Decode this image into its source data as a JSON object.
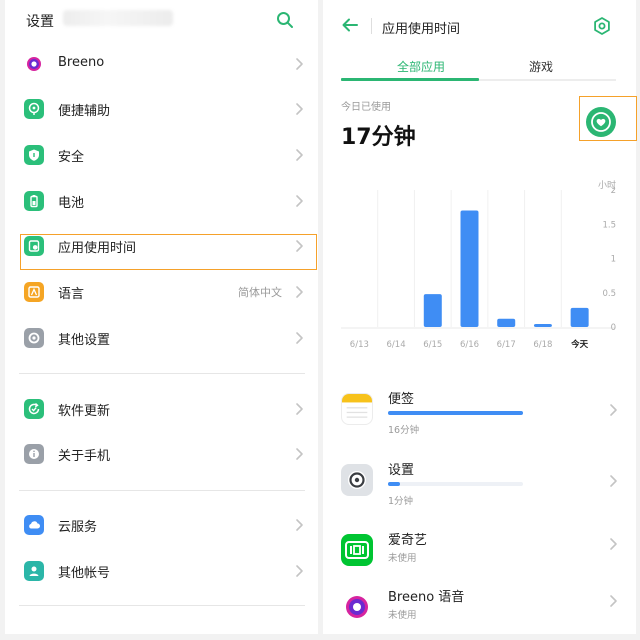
{
  "left": {
    "title": "设置",
    "groups": [
      [
        {
          "label": "Breeno",
          "value": "",
          "icon": "breeno-icon",
          "color": "#ffffff"
        },
        {
          "label": "便捷辅助",
          "value": "",
          "icon": "assist-icon",
          "color": "#2bbf7a"
        },
        {
          "label": "安全",
          "value": "",
          "icon": "security-shield-icon",
          "color": "#2bbf7a"
        },
        {
          "label": "电池",
          "value": "",
          "icon": "battery-icon",
          "color": "#2bbf7a"
        },
        {
          "label": "应用使用时间",
          "value": "",
          "icon": "app-usage-icon",
          "color": "#2bbf7a"
        },
        {
          "label": "语言",
          "value": "简体中文",
          "icon": "language-icon",
          "color": "#f5a524"
        },
        {
          "label": "其他设置",
          "value": "",
          "icon": "other-settings-icon",
          "color": "#9aa0a8"
        }
      ],
      [
        {
          "label": "软件更新",
          "value": "",
          "icon": "update-icon",
          "color": "#2bbf7a"
        },
        {
          "label": "关于手机",
          "value": "",
          "icon": "about-phone-icon",
          "color": "#9aa0a8"
        }
      ],
      [
        {
          "label": "云服务",
          "value": "",
          "icon": "cloud-icon",
          "color": "#3f8df4"
        },
        {
          "label": "其他帐号",
          "value": "",
          "icon": "account-icon",
          "color": "#2bb6a8"
        }
      ]
    ]
  },
  "right": {
    "title": "应用使用时间",
    "tabs": [
      "全部应用",
      "游戏"
    ],
    "today_label": "今日已使用",
    "today_value": "17分钟",
    "apps": [
      {
        "name": "便签",
        "usage": "16分钟",
        "fraction": 1.0,
        "icon": "notes-icon"
      },
      {
        "name": "设置",
        "usage": "1分钟",
        "fraction": 0.09,
        "icon": "settings-app-icon"
      },
      {
        "name": "爱奇艺",
        "usage": "未使用",
        "fraction": null,
        "icon": "iqiyi-icon"
      },
      {
        "name": "Breeno 语音",
        "usage": "未使用",
        "fraction": null,
        "icon": "breeno-voice-icon"
      }
    ]
  },
  "colors": {
    "accent": "#2bb673",
    "bar": "#3f8df4",
    "highlight": "#f5a12a"
  },
  "chart_data": {
    "type": "bar",
    "categories": [
      "6/13",
      "6/14",
      "6/15",
      "6/16",
      "6/17",
      "6/18",
      "今天"
    ],
    "values": [
      0,
      0,
      0.48,
      1.7,
      0.12,
      0.04,
      0.28
    ],
    "ylabel": "小时",
    "yticks": [
      "2",
      "1.5",
      "1",
      "0.5",
      "0"
    ],
    "ylim": [
      0,
      2
    ],
    "grid": true
  }
}
